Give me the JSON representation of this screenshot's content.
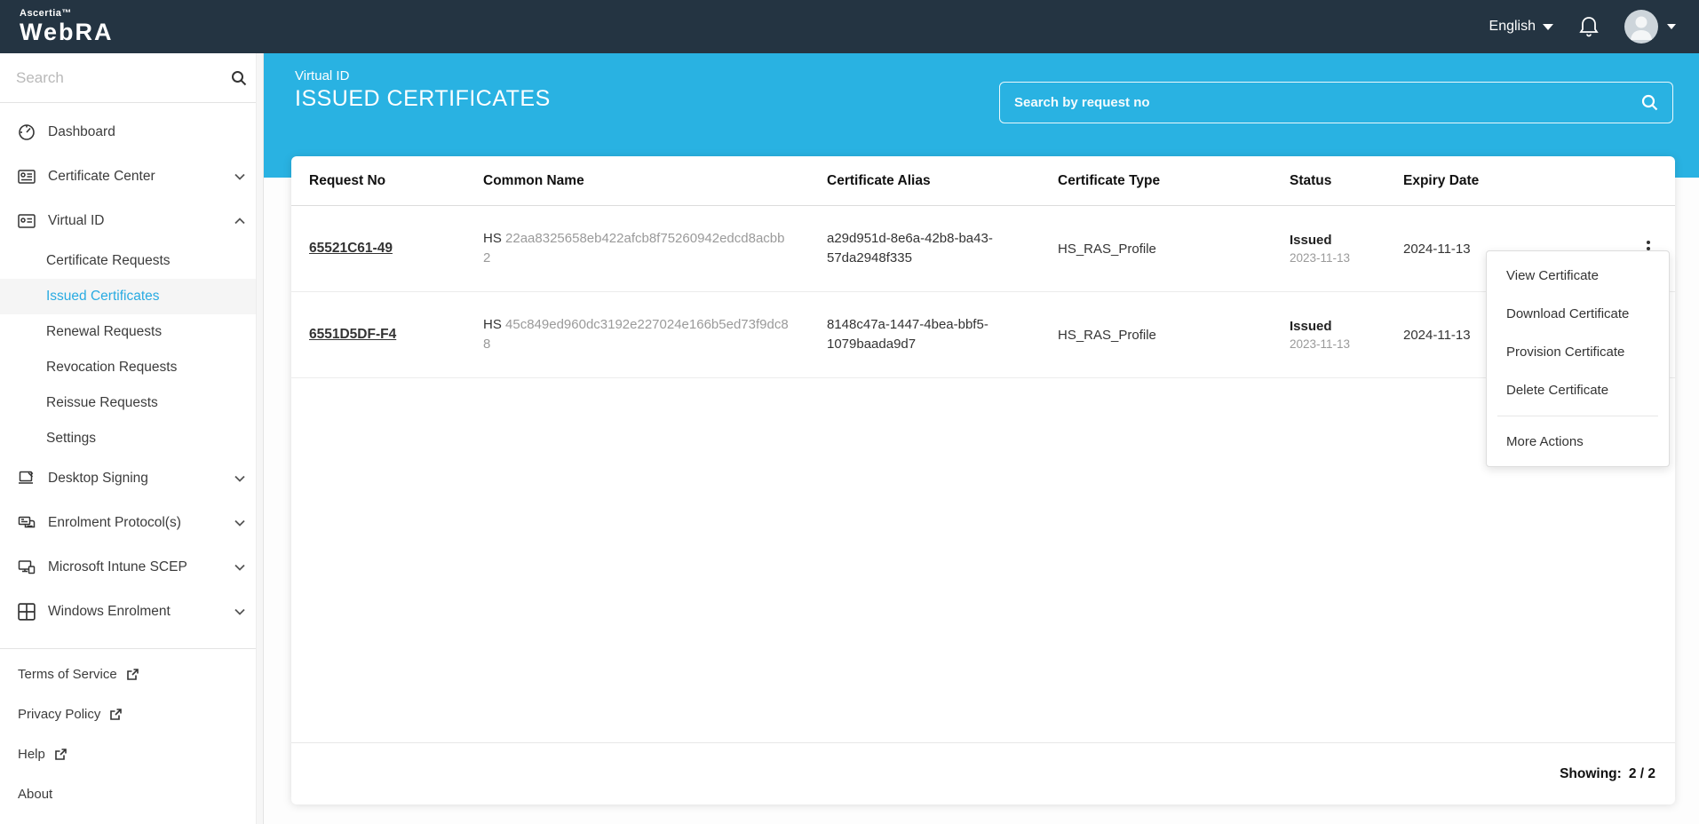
{
  "navbar": {
    "brand_top": "Ascertia™",
    "brand_main": "WebRA",
    "language_label": "English",
    "icons": [
      "language-caret-icon",
      "bell-icon",
      "avatar",
      "avatar-caret-icon"
    ]
  },
  "sidebar": {
    "search_placeholder": "Search",
    "items": [
      {
        "label": "Dashboard",
        "icon": "dashboard-icon",
        "expandable": false
      },
      {
        "label": "Certificate Center",
        "icon": "certificate-center-icon",
        "expandable": true,
        "state": "collapsed"
      },
      {
        "label": "Virtual ID",
        "icon": "virtual-id-icon",
        "expandable": true,
        "state": "expanded"
      }
    ],
    "virtual_id_children": [
      {
        "label": "Certificate Requests",
        "active": false
      },
      {
        "label": "Issued Certificates",
        "active": true
      },
      {
        "label": "Renewal Requests",
        "active": false
      },
      {
        "label": "Revocation Requests",
        "active": false
      },
      {
        "label": "Reissue Requests",
        "active": false
      },
      {
        "label": "Settings",
        "active": false
      }
    ],
    "items_lower": [
      {
        "label": "Desktop Signing",
        "icon": "desktop-signing-icon",
        "state": "collapsed"
      },
      {
        "label": "Enrolment Protocol(s)",
        "icon": "enrolment-protocol-icon",
        "state": "collapsed"
      },
      {
        "label": "Microsoft Intune SCEP",
        "icon": "intune-scep-icon",
        "state": "collapsed"
      },
      {
        "label": "Windows Enrolment",
        "icon": "windows-icon",
        "state": "collapsed"
      }
    ],
    "footer_links": [
      {
        "label": "Terms of Service",
        "external": true
      },
      {
        "label": "Privacy Policy",
        "external": true
      },
      {
        "label": "Help",
        "external": true
      },
      {
        "label": "About",
        "external": false
      }
    ]
  },
  "header": {
    "breadcrumb": "Virtual ID",
    "title": "ISSUED CERTIFICATES",
    "search_placeholder": "Search by request no"
  },
  "table": {
    "columns": [
      "Request No",
      "Common Name",
      "Certificate Alias",
      "Certificate Type",
      "Status",
      "Expiry Date"
    ],
    "rows": [
      {
        "request_no": "65521C61-49",
        "common_name_prefix": "HS",
        "common_name_hash": "22aa8325658eb422afcb8f75260942edcd8acbb2",
        "certificate_alias": "a29d951d-8e6a-42b8-ba43-57da2948f335",
        "certificate_type": "HS_RAS_Profile",
        "status": "Issued",
        "status_date": "2023-11-13",
        "expiry_date": "2024-11-13"
      },
      {
        "request_no": "6551D5DF-F4",
        "common_name_prefix": "HS",
        "common_name_hash": "45c849ed960dc3192e227024e166b5ed73f9dc88",
        "certificate_alias": "8148c47a-1447-4bea-bbf5-1079baada9d7",
        "certificate_type": "HS_RAS_Profile",
        "status": "Issued",
        "status_date": "2023-11-13",
        "expiry_date": "2024-11-13"
      }
    ],
    "footer": {
      "showing_label": "Showing:",
      "showing_value": "2 / 2"
    }
  },
  "context_menu": {
    "items": [
      "View Certificate",
      "Download Certificate",
      "Provision Certificate",
      "Delete Certificate"
    ],
    "more_label": "More Actions"
  },
  "colors": {
    "navbar_bg": "#243442",
    "accent_cyan": "#29b2e2",
    "active_link": "#29abe2",
    "muted_text": "#9a9a9a"
  }
}
